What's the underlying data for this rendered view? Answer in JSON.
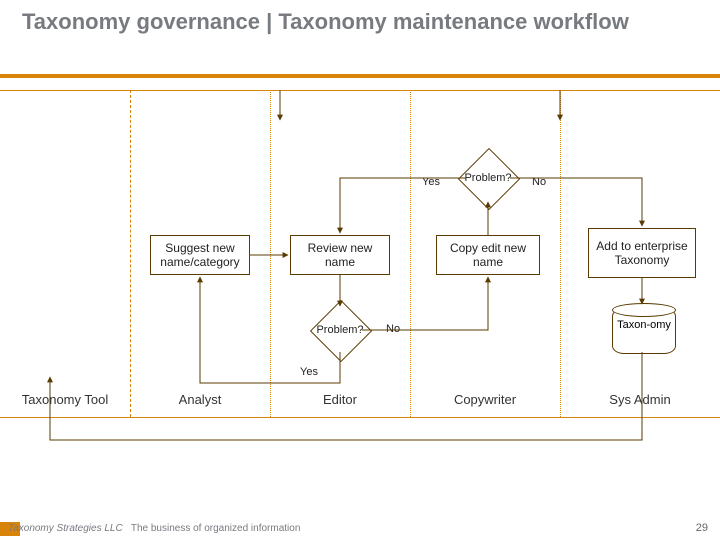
{
  "header": {
    "title": "Taxonomy governance  |  Taxonomy maintenance workflow"
  },
  "lanes": {
    "tool": {
      "role": "Taxonomy Tool"
    },
    "analyst": {
      "role": "Analyst",
      "box": "Suggest new name/category"
    },
    "editor": {
      "role": "Editor",
      "box": "Review new name",
      "decision": "Problem?"
    },
    "copywriter": {
      "role": "Copywriter",
      "box": "Copy edit new name",
      "decision": "Problem?"
    },
    "sysadmin": {
      "role": "Sys Admin",
      "box": "Add to enterprise Taxonomy",
      "db": "Taxon-omy"
    }
  },
  "labels": {
    "yes1": "Yes",
    "no1": "No",
    "yes2": "Yes",
    "no2": "No"
  },
  "footer": {
    "company": "Taxonomy Strategies LLC",
    "tagline": "The business of organized information",
    "page": "29"
  }
}
